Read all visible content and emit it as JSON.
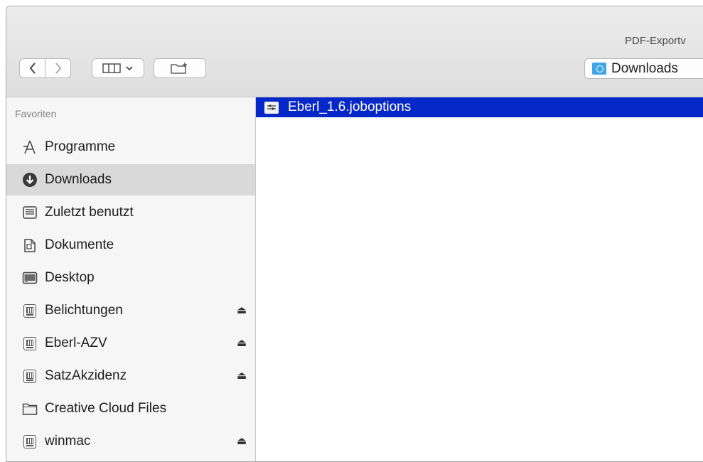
{
  "window": {
    "title": "PDF-Exportv"
  },
  "toolbar": {
    "back_icon": "chevron-left",
    "forward_icon": "chevron-right",
    "view_icon": "columns-view",
    "new_folder_icon": "new-folder",
    "path_label": "Downloads"
  },
  "sidebar": {
    "section_title": "Favoriten",
    "items": [
      {
        "label": "Programme",
        "icon": "applications-icon",
        "eject": false
      },
      {
        "label": "Downloads",
        "icon": "downloads-icon",
        "eject": false,
        "selected": true
      },
      {
        "label": "Zuletzt benutzt",
        "icon": "recents-icon",
        "eject": false
      },
      {
        "label": "Dokumente",
        "icon": "documents-icon",
        "eject": false
      },
      {
        "label": "Desktop",
        "icon": "desktop-icon",
        "eject": false
      },
      {
        "label": "Belichtungen",
        "icon": "network-drive-icon",
        "eject": true
      },
      {
        "label": "Eberl-AZV",
        "icon": "network-drive-icon",
        "eject": true
      },
      {
        "label": "SatzAkzidenz",
        "icon": "network-drive-icon",
        "eject": true
      },
      {
        "label": "Creative Cloud Files",
        "icon": "folder-icon",
        "eject": false
      },
      {
        "label": "winmac",
        "icon": "network-drive-icon",
        "eject": true
      }
    ],
    "eject_glyph": "⏏"
  },
  "files": [
    {
      "name": "Eberl_1.6.joboptions",
      "icon": "settings-file-icon",
      "selected": true
    }
  ],
  "colors": {
    "selection": "#0628c8",
    "sidebar_selected": "#d9d9d9",
    "folder_accent": "#3ea6e6"
  }
}
